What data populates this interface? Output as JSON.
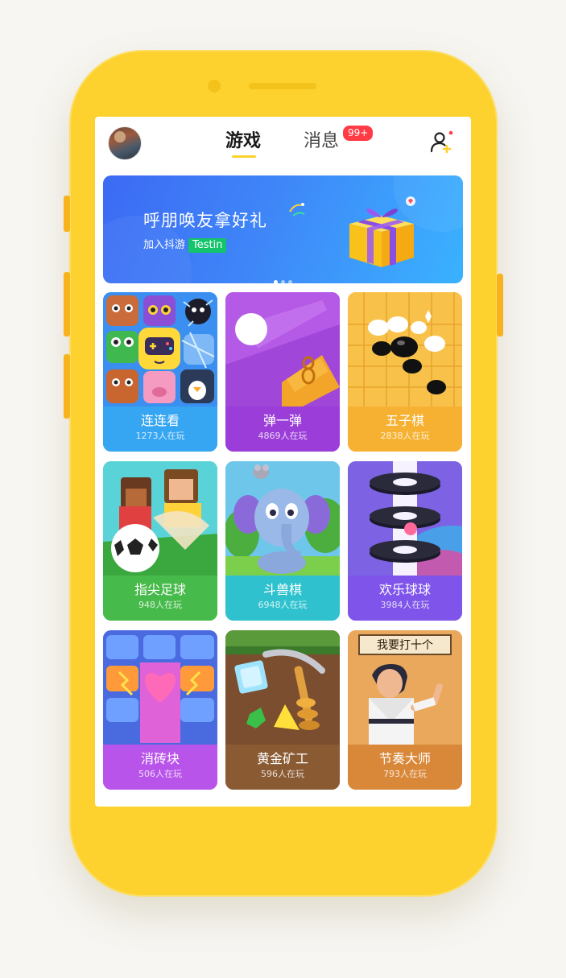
{
  "header": {
    "tabs": [
      {
        "label": "游戏",
        "active": true
      },
      {
        "label": "消息",
        "active": false
      }
    ],
    "message_badge": "99+"
  },
  "banner": {
    "title": "呼朋唤友拿好礼",
    "subtitle": "加入抖游",
    "tag": "Testin",
    "dots": 3,
    "active_dot": 0
  },
  "games": [
    {
      "name": "连连看",
      "players": "1273人在玩",
      "icon": "cube-faces-icon"
    },
    {
      "name": "弹一弹",
      "players": "4869人在玩",
      "icon": "bouncing-ball-icon"
    },
    {
      "name": "五子棋",
      "players": "2838人在玩",
      "icon": "go-stones-icon"
    },
    {
      "name": "指尖足球",
      "players": "948人在玩",
      "icon": "soccer-ball-icon"
    },
    {
      "name": "斗兽棋",
      "players": "6948人在玩",
      "icon": "elephant-icon"
    },
    {
      "name": "欢乐球球",
      "players": "3984人在玩",
      "icon": "helix-tower-icon"
    },
    {
      "name": "消砖块",
      "players": "506人在玩",
      "icon": "heart-brick-icon"
    },
    {
      "name": "黄金矿工",
      "players": "596人在玩",
      "icon": "pickaxe-gem-icon"
    },
    {
      "name": "节奏大师",
      "players": "793人在玩",
      "icon": "kungfu-master-icon"
    }
  ],
  "kungfu_sign": "我要打十个",
  "colors": {
    "phone": "#fdd22e",
    "tab_underline": "#fdd22e",
    "badge": "#ff3b46",
    "banner_tag": "#13c46a"
  }
}
